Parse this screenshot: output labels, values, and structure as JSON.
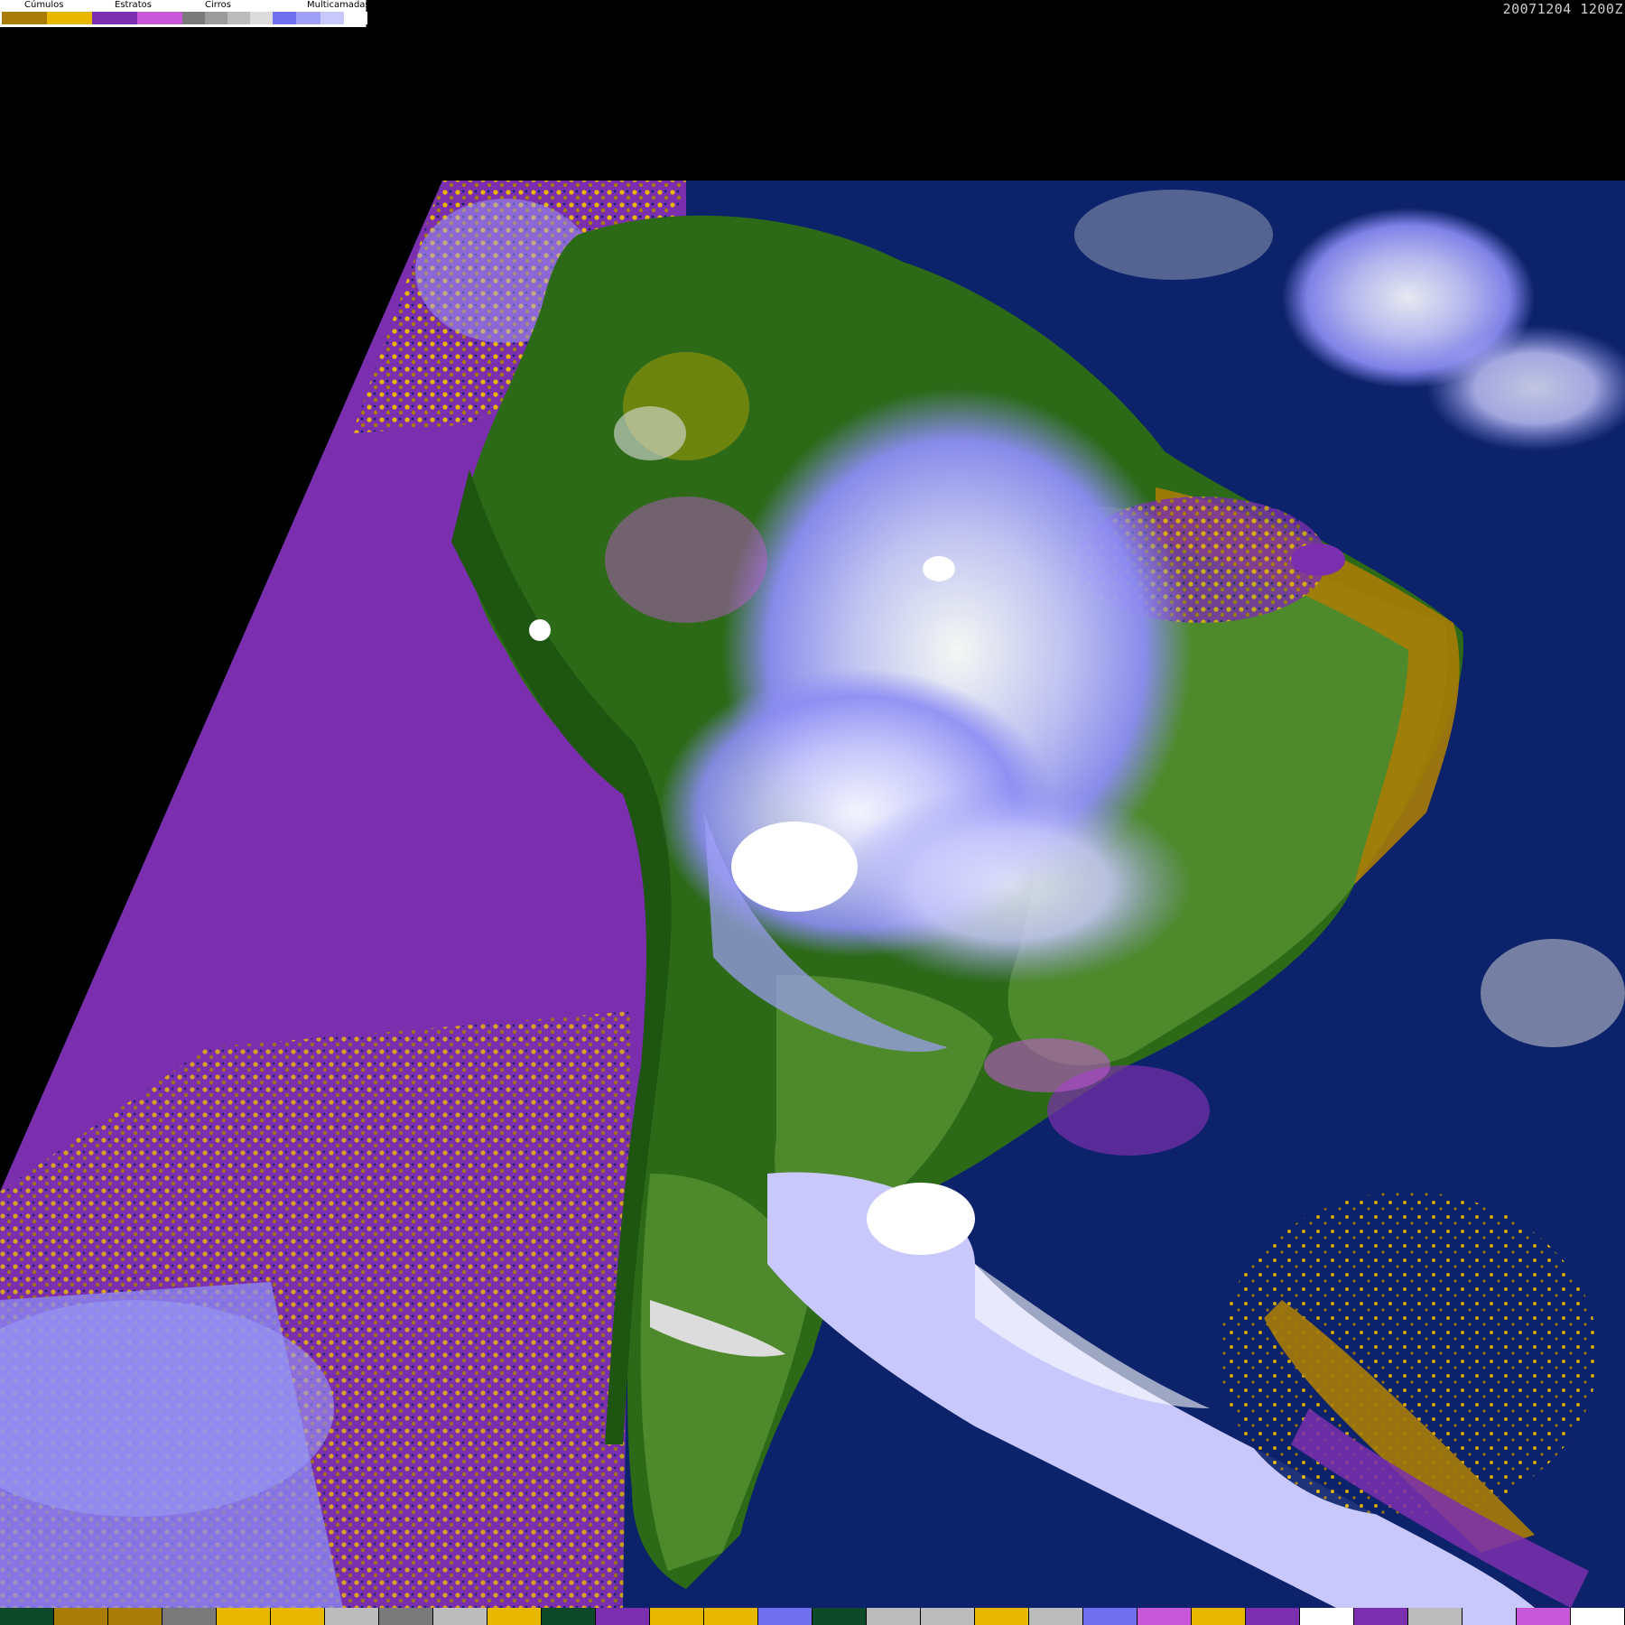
{
  "timestamp": "20071204 1200Z",
  "legend": {
    "groups": [
      {
        "label": "Cúmulos",
        "swatches": [
          "#a87c06",
          "#e8b800"
        ]
      },
      {
        "label": "Estratos",
        "swatches": [
          "#7b2fae",
          "#c858d8"
        ]
      },
      {
        "label": "Cirros",
        "swatches": [
          "#7a7a7a",
          "#9c9c9c",
          "#bcbcbc",
          "#dcdcdc"
        ]
      },
      {
        "label": "Multicamadas",
        "swatches": [
          "#7070f0",
          "#a0a0f8",
          "#c8c8fc",
          "#ffffff"
        ]
      }
    ]
  },
  "colors": {
    "ocean": "#0c226a",
    "land_forest": "#2c6a18",
    "land_green": "#4e8a2c",
    "stratus_ocean": "#7b2fae",
    "cumulus_dark": "#a87c06",
    "cumulus_bright": "#e8b800",
    "multi_light": "#c8c8fc",
    "multi_mid": "#8c8cf4",
    "white": "#ffffff"
  },
  "bottom_bar": [
    "#0e4a2a",
    "#a87c06",
    "#a87c06",
    "#7a7a7a",
    "#e8b800",
    "#e8b800",
    "#bcbcbc",
    "#7a7a7a",
    "#bcbcbc",
    "#e8b800",
    "#0e4a2a",
    "#7b2fae",
    "#e8b800",
    "#e8b800",
    "#7070f0",
    "#0e4a2a",
    "#bcbcbc",
    "#bcbcbc",
    "#e8b800",
    "#bcbcbc",
    "#7070f0",
    "#c858d8",
    "#e8b800",
    "#7b2fae",
    "#ffffff",
    "#7b2fae",
    "#bcbcbc",
    "#c8c8fc",
    "#c858d8",
    "#ffffff"
  ]
}
